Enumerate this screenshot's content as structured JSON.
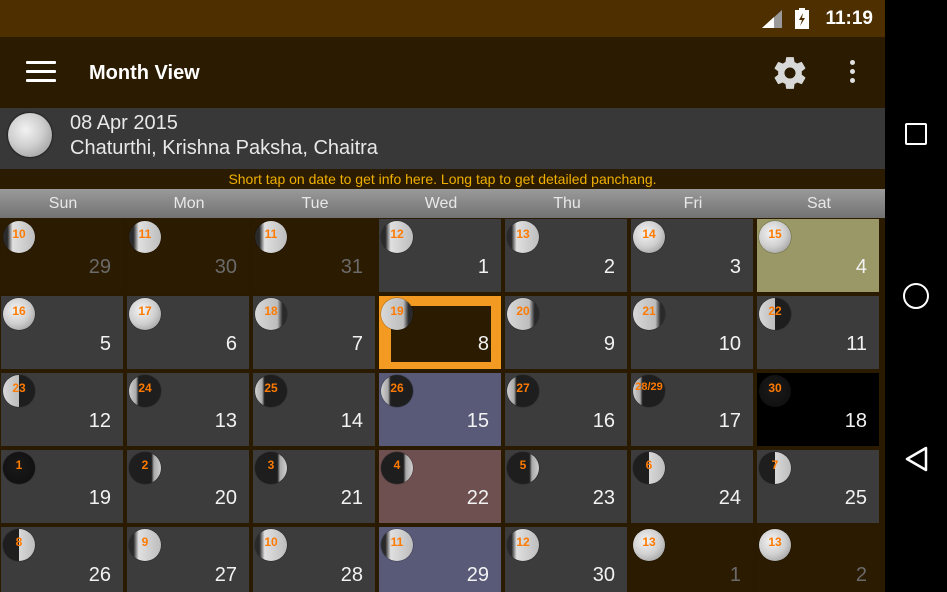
{
  "status": {
    "time": "11:19"
  },
  "app_bar": {
    "title": "Month View"
  },
  "info": {
    "date": "08 Apr 2015",
    "tithi": "Chaturthi, Krishna Paksha, Chaitra"
  },
  "hint": "Short tap on date to get info here. Long tap to get detailed panchang.",
  "weekdays": [
    "Sun",
    "Mon",
    "Tue",
    "Wed",
    "Thu",
    "Fri",
    "Sat"
  ],
  "colors": {
    "accent_orange": "#f29a22",
    "tithi_number": "#ff7a00",
    "status_bar": "#4e3000",
    "app_bar": "#2b1b00"
  },
  "cells": [
    {
      "day": "29",
      "tithi": "10",
      "phase": "waxing-gibbous",
      "type": "other"
    },
    {
      "day": "30",
      "tithi": "11",
      "phase": "waxing-gibbous",
      "type": "other"
    },
    {
      "day": "31",
      "tithi": "11",
      "phase": "waxing-gibbous",
      "type": "other"
    },
    {
      "day": "1",
      "tithi": "12",
      "phase": "waxing-gibbous",
      "type": "normal"
    },
    {
      "day": "2",
      "tithi": "13",
      "phase": "waxing-gibbous",
      "type": "normal"
    },
    {
      "day": "3",
      "tithi": "14",
      "phase": "full",
      "type": "normal"
    },
    {
      "day": "4",
      "tithi": "15",
      "phase": "full",
      "type": "purnima"
    },
    {
      "day": "5",
      "tithi": "16",
      "phase": "full",
      "type": "normal"
    },
    {
      "day": "6",
      "tithi": "17",
      "phase": "full",
      "type": "normal"
    },
    {
      "day": "7",
      "tithi": "18",
      "phase": "waning-gibbous",
      "type": "normal"
    },
    {
      "day": "8",
      "tithi": "19",
      "phase": "waning-gibbous",
      "type": "selected"
    },
    {
      "day": "9",
      "tithi": "20",
      "phase": "waning-gibbous",
      "type": "normal"
    },
    {
      "day": "10",
      "tithi": "21",
      "phase": "waning-gibbous",
      "type": "normal"
    },
    {
      "day": "11",
      "tithi": "22",
      "phase": "last-quarter",
      "type": "normal"
    },
    {
      "day": "12",
      "tithi": "23",
      "phase": "last-quarter",
      "type": "normal"
    },
    {
      "day": "13",
      "tithi": "24",
      "phase": "waning-crescent",
      "type": "normal"
    },
    {
      "day": "14",
      "tithi": "25",
      "phase": "waning-crescent",
      "type": "normal"
    },
    {
      "day": "15",
      "tithi": "26",
      "phase": "waning-crescent",
      "type": "highlight-blue"
    },
    {
      "day": "16",
      "tithi": "27",
      "phase": "waning-crescent",
      "type": "normal"
    },
    {
      "day": "17",
      "tithi": "28/29",
      "phase": "waning-crescent",
      "type": "normal"
    },
    {
      "day": "18",
      "tithi": "30",
      "phase": "new",
      "type": "amavasya"
    },
    {
      "day": "19",
      "tithi": "1",
      "phase": "new",
      "type": "normal"
    },
    {
      "day": "20",
      "tithi": "2",
      "phase": "waxing-crescent",
      "type": "normal"
    },
    {
      "day": "21",
      "tithi": "3",
      "phase": "waxing-crescent",
      "type": "normal"
    },
    {
      "day": "22",
      "tithi": "4",
      "phase": "waxing-crescent",
      "type": "highlight-red"
    },
    {
      "day": "23",
      "tithi": "5",
      "phase": "waxing-crescent",
      "type": "normal"
    },
    {
      "day": "24",
      "tithi": "6",
      "phase": "first-quarter",
      "type": "normal"
    },
    {
      "day": "25",
      "tithi": "7",
      "phase": "first-quarter",
      "type": "normal"
    },
    {
      "day": "26",
      "tithi": "8",
      "phase": "first-quarter",
      "type": "normal"
    },
    {
      "day": "27",
      "tithi": "9",
      "phase": "waxing-gibbous",
      "type": "normal"
    },
    {
      "day": "28",
      "tithi": "10",
      "phase": "waxing-gibbous",
      "type": "normal"
    },
    {
      "day": "29",
      "tithi": "11",
      "phase": "waxing-gibbous",
      "type": "highlight-blue"
    },
    {
      "day": "30",
      "tithi": "12",
      "phase": "waxing-gibbous",
      "type": "normal"
    },
    {
      "day": "1",
      "tithi": "13",
      "phase": "full",
      "type": "other"
    },
    {
      "day": "2",
      "tithi": "13",
      "phase": "full",
      "type": "other"
    }
  ]
}
